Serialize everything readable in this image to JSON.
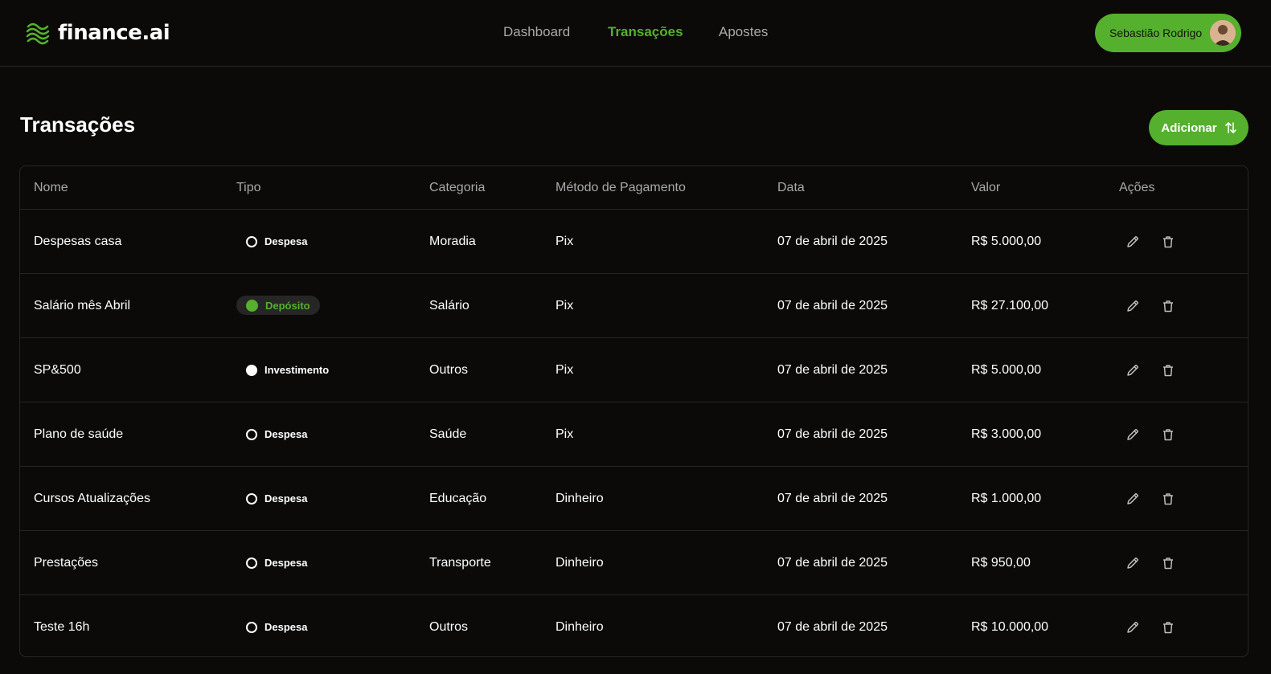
{
  "brand": {
    "name": "finance.ai",
    "accent": "#55b02e"
  },
  "nav": {
    "items": [
      {
        "label": "Dashboard",
        "active": false
      },
      {
        "label": "Transações",
        "active": true
      },
      {
        "label": "Apostes",
        "active": false
      }
    ]
  },
  "user": {
    "name": "Sebastião Rodrigo",
    "avatar_icon": "user-avatar"
  },
  "page": {
    "title": "Transações",
    "add_label": "Adicionar",
    "add_icon": "sort-arrows-icon"
  },
  "table": {
    "columns": [
      "Nome",
      "Tipo",
      "Categoria",
      "Método de Pagamento",
      "Data",
      "Valor",
      "Ações"
    ],
    "rows": [
      {
        "nome": "Despesas casa",
        "tipo": "Despesa",
        "categoria": "Moradia",
        "metodo": "Pix",
        "data": "07 de abril de 2025",
        "valor": "R$ 5.000,00"
      },
      {
        "nome": "Salário mês Abril",
        "tipo": "Depósito",
        "categoria": "Salário",
        "metodo": "Pix",
        "data": "07 de abril de 2025",
        "valor": "R$ 27.100,00"
      },
      {
        "nome": "SP&500",
        "tipo": "Investimento",
        "categoria": "Outros",
        "metodo": "Pix",
        "data": "07 de abril de 2025",
        "valor": "R$ 5.000,00"
      },
      {
        "nome": "Plano de saúde",
        "tipo": "Despesa",
        "categoria": "Saúde",
        "metodo": "Pix",
        "data": "07 de abril de 2025",
        "valor": "R$ 3.000,00"
      },
      {
        "nome": "Cursos Atualizações",
        "tipo": "Despesa",
        "categoria": "Educação",
        "metodo": "Dinheiro",
        "data": "07 de abril de 2025",
        "valor": "R$ 1.000,00"
      },
      {
        "nome": "Prestações",
        "tipo": "Despesa",
        "categoria": "Transporte",
        "metodo": "Dinheiro",
        "data": "07 de abril de 2025",
        "valor": "R$ 950,00"
      },
      {
        "nome": "Teste 16h",
        "tipo": "Despesa",
        "categoria": "Outros",
        "metodo": "Dinheiro",
        "data": "07 de abril de 2025",
        "valor": "R$ 10.000,00"
      }
    ],
    "action_icons": [
      "pencil-icon",
      "trash-icon"
    ]
  }
}
